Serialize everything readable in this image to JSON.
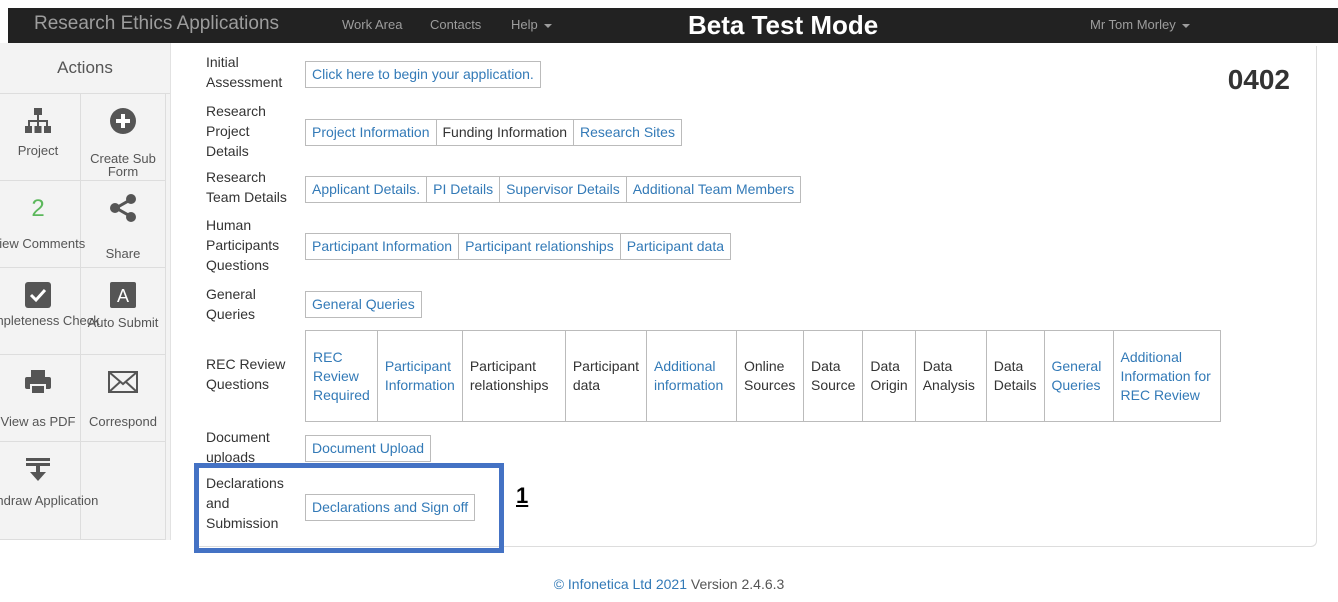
{
  "navbar": {
    "brand": "Research Ethics Applications",
    "links": [
      "Work Area",
      "Contacts",
      "Help"
    ],
    "beta": "Beta Test Mode",
    "user": "Mr Tom Morley"
  },
  "sidebar": {
    "header": "Actions",
    "tiles": [
      {
        "label": "Project",
        "icon": "sitemap-icon"
      },
      {
        "label": "Create Sub Form",
        "icon": "plus-circle-icon"
      },
      {
        "label": "View Comments",
        "count": "2",
        "icon": "comments-count"
      },
      {
        "label": "Share",
        "icon": "share-icon"
      },
      {
        "label": "Completeness Check",
        "icon": "checkbox-icon"
      },
      {
        "label": "Auto Submit",
        "icon": "letter-a-icon"
      },
      {
        "label": "View as PDF",
        "icon": "printer-icon"
      },
      {
        "label": "Correspond",
        "icon": "envelope-icon"
      },
      {
        "label": "Withdraw Application",
        "icon": "withdraw-icon"
      }
    ]
  },
  "form": {
    "number": "0402",
    "rows": [
      {
        "label": "Initial Assessment",
        "tabs": [
          {
            "text": "Click here to begin your application.",
            "link": true
          }
        ]
      },
      {
        "label": "Research Project Details",
        "tabs": [
          {
            "text": "Project Information",
            "link": true
          },
          {
            "text": "Funding Information",
            "link": false
          },
          {
            "text": "Research Sites",
            "link": true
          }
        ]
      },
      {
        "label": "Research Team Details",
        "tabs": [
          {
            "text": "Applicant Details.",
            "link": true
          },
          {
            "text": "PI Details",
            "link": true
          },
          {
            "text": "Supervisor Details",
            "link": true
          },
          {
            "text": "Additional Team Members",
            "link": true
          }
        ]
      },
      {
        "label": "Human Participants Questions",
        "tabs": [
          {
            "text": "Participant Information",
            "link": true
          },
          {
            "text": "Participant relationships",
            "link": true
          },
          {
            "text": "Participant data",
            "link": true
          }
        ]
      },
      {
        "label": "General Queries",
        "tabs": [
          {
            "text": "General Queries",
            "link": true
          }
        ]
      },
      {
        "label": "REC Review Questions",
        "tabs": [
          {
            "text": "REC Review Required",
            "link": true
          },
          {
            "text": "Participant Information",
            "link": true
          },
          {
            "text": "Participant relationships",
            "link": false
          },
          {
            "text": "Participant data",
            "link": false
          },
          {
            "text": "Additional information",
            "link": true
          },
          {
            "text": "Online Sources",
            "link": false
          },
          {
            "text": "Data Source",
            "link": false
          },
          {
            "text": "Data Origin",
            "link": false
          },
          {
            "text": "Data Analysis",
            "link": false
          },
          {
            "text": "Data Details",
            "link": false
          },
          {
            "text": "General Queries",
            "link": true
          },
          {
            "text": "Additional Information for REC Review",
            "link": true
          }
        ]
      },
      {
        "label": "Document uploads",
        "tabs": [
          {
            "text": "Document Upload",
            "link": true
          }
        ]
      },
      {
        "label": "Declarations and Submission",
        "tabs": [
          {
            "text": "Declarations and Sign off",
            "link": true
          }
        ]
      }
    ]
  },
  "callout": "1",
  "footer": {
    "link": "© Infonetica Ltd 2021",
    "version": "Version 2.4.6.3"
  },
  "colors": {
    "link": "#337ab7",
    "highlight": "#4472c4",
    "navbar": "#222222",
    "comments_count": "#5cb85c"
  }
}
